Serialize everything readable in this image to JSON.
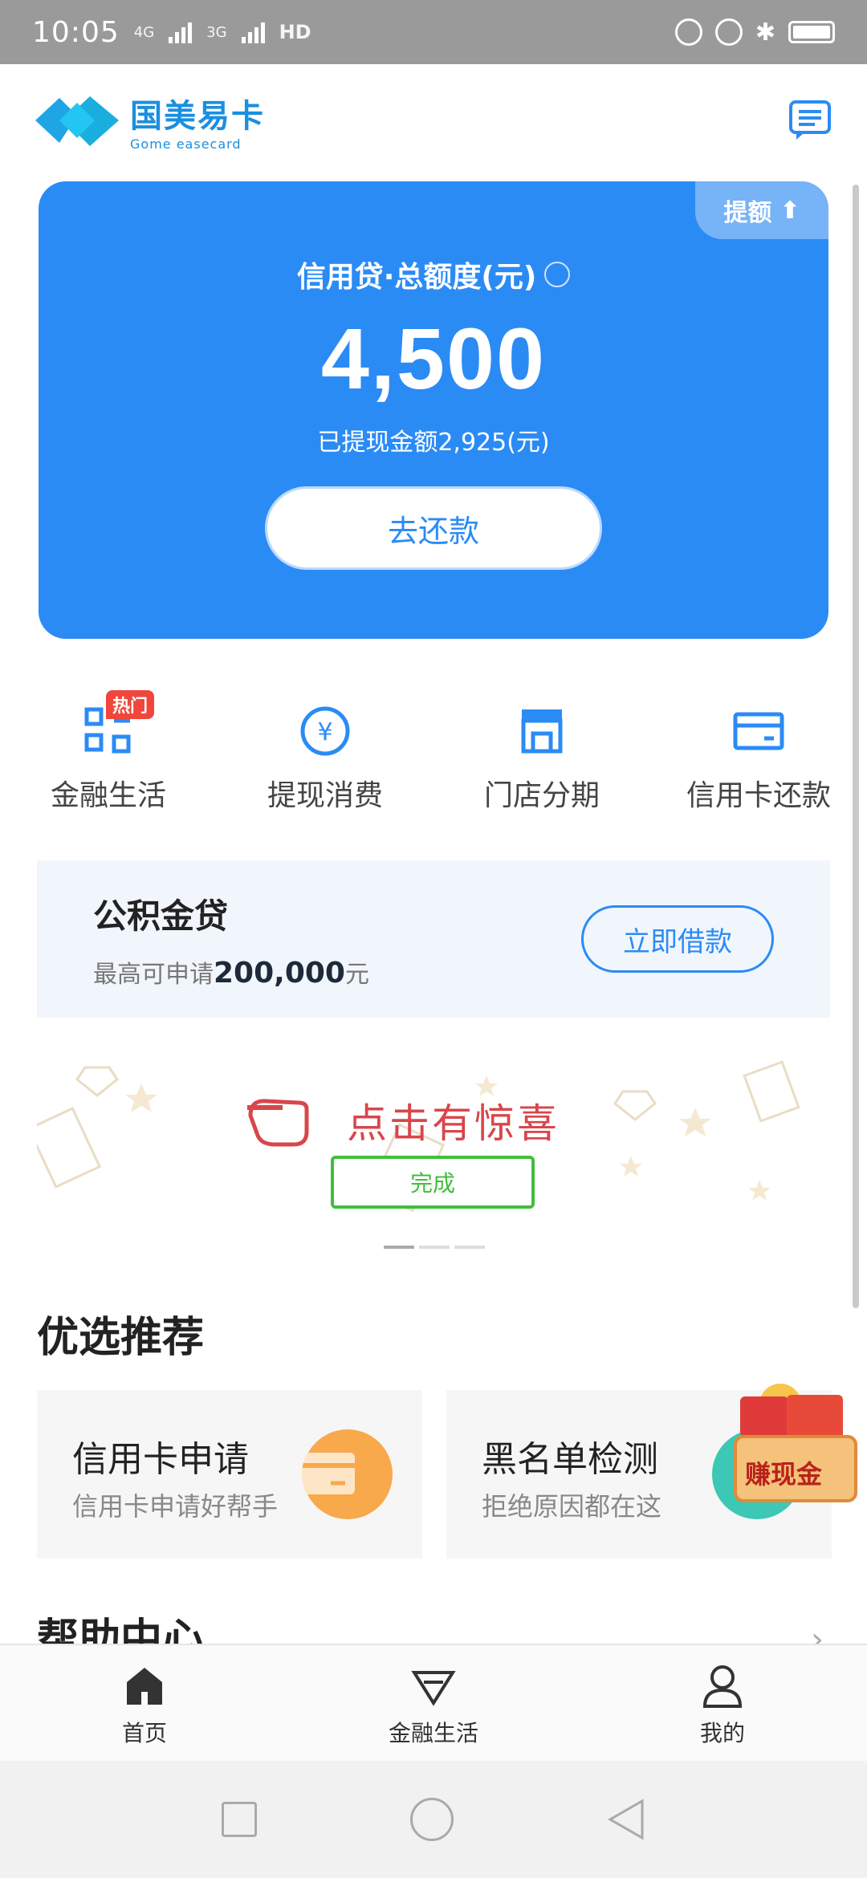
{
  "status_bar": {
    "time": "10:05",
    "network_1": "4G",
    "network_2": "3G",
    "hd": "HD"
  },
  "header": {
    "brand_cn": "国美易卡",
    "brand_en": "Gome easecard",
    "logo_mark_text": "Gome easecard"
  },
  "credit": {
    "raise_label": "提额",
    "title": "信用贷·总额度(元)",
    "amount": "4,500",
    "used": "已提现金额2,925(元)",
    "repay_label": "去还款",
    "bg_color": "#2b8bf5"
  },
  "quick_menu": {
    "items": [
      {
        "label": "金融生活",
        "icon": "apps-icon",
        "badge": "热门"
      },
      {
        "label": "提现消费",
        "icon": "yuan-icon"
      },
      {
        "label": "门店分期",
        "icon": "store-icon"
      },
      {
        "label": "信用卡还款",
        "icon": "card-icon"
      }
    ]
  },
  "fund_loan": {
    "title": "公积金贷",
    "sub_prefix": "最高可申请",
    "sub_amount": "200,000",
    "sub_suffix": "元",
    "button": "立即借款"
  },
  "banner": {
    "text": "点击有惊喜",
    "button": "完成"
  },
  "recommend": {
    "title": "优选推荐",
    "items": [
      {
        "title": "信用卡申请",
        "sub": "信用卡申请好帮手"
      },
      {
        "title": "黑名单检测",
        "sub": "拒绝原因都在这"
      }
    ],
    "float_badge": "赚现金"
  },
  "help": {
    "title": "帮助中心"
  },
  "tabbar": {
    "items": [
      {
        "label": "首页",
        "icon": "home-icon"
      },
      {
        "label": "金融生活",
        "icon": "diamond-icon"
      },
      {
        "label": "我的",
        "icon": "user-icon"
      }
    ]
  }
}
